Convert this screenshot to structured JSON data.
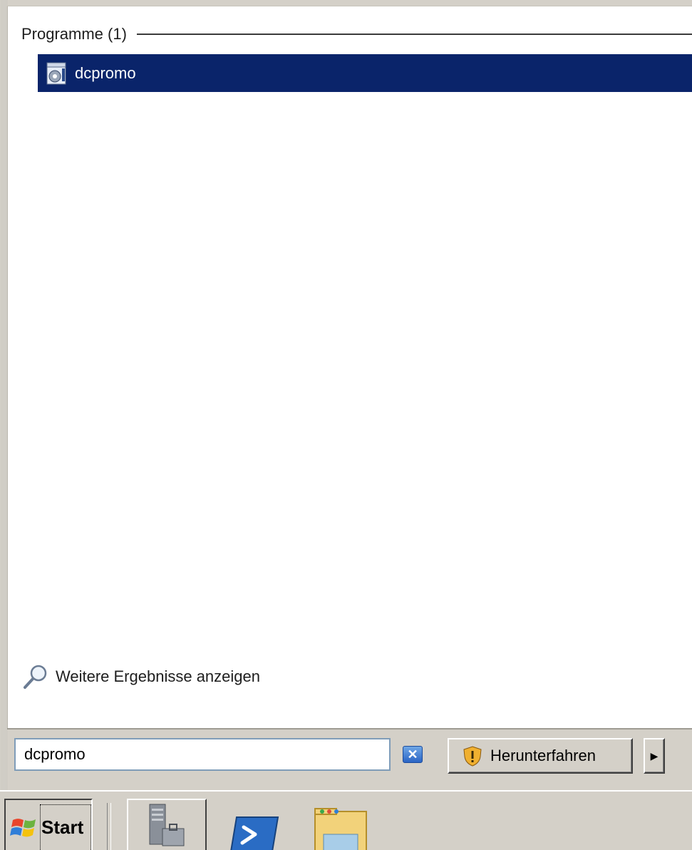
{
  "start_menu": {
    "section_header": "Programme (1)",
    "results": [
      {
        "label": "dcpromo",
        "icon": "dcpromo-app-icon",
        "selected": true
      }
    ],
    "more_results_label": "Weitere Ergebnisse anzeigen",
    "search": {
      "value": "dcpromo",
      "clear_icon": "close-icon"
    },
    "shutdown": {
      "label": "Herunterfahren",
      "icon": "shield-warning-icon",
      "arrow_icon": "triangle-right-icon"
    }
  },
  "taskbar": {
    "start_label": "Start",
    "pinned": [
      {
        "name": "server-manager-icon"
      },
      {
        "name": "powershell-icon"
      },
      {
        "name": "explorer-folder-icon"
      }
    ]
  },
  "colors": {
    "selection": "#0a246a",
    "chrome": "#d4d0c8",
    "results_bg": "#ffffff"
  }
}
